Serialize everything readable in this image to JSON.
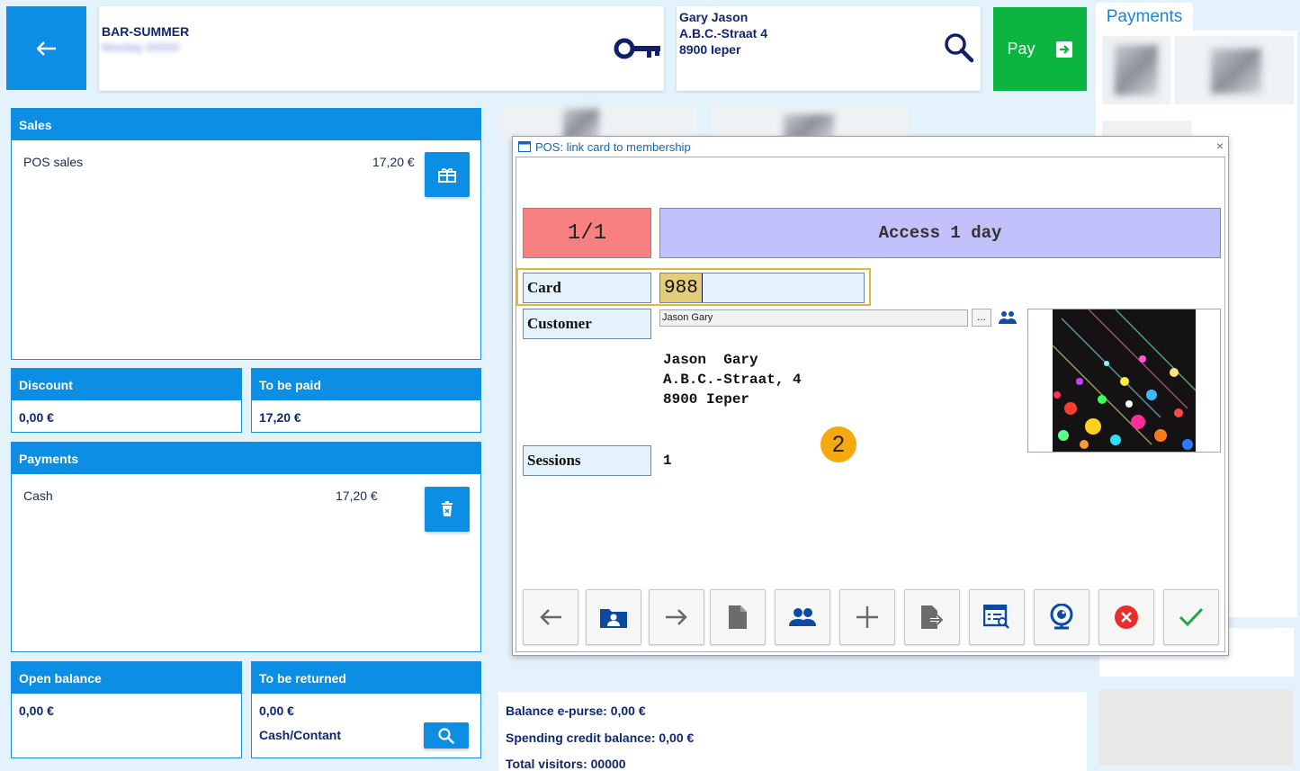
{
  "header": {
    "shop_name": "BAR-SUMMER",
    "shop_sub": "Monday 00000",
    "customer_lines": [
      "Gary  Jason",
      "A.B.C.-Straat 4",
      "8900 Ieper"
    ],
    "pay_label": "Pay",
    "payments_tab": "Payments"
  },
  "sales": {
    "title": "Sales",
    "item_label": "POS sales",
    "item_value": "17,20 €"
  },
  "discount": {
    "title": "Discount",
    "value": "0,00 €"
  },
  "to_be_paid": {
    "title": "To be paid",
    "value": "17,20 €"
  },
  "payments": {
    "title": "Payments",
    "item_label": "Cash",
    "item_value": "17,20 €"
  },
  "open_balance": {
    "title": "Open balance",
    "value": "0,00 €"
  },
  "to_be_returned": {
    "title": "To be returned",
    "value": "0,00 €",
    "method": "Cash/Contant"
  },
  "bottom_info": {
    "line1": "Balance e-purse: 0,00 €",
    "line2": "Spending credit balance: 0,00 €",
    "line3": "Total visitors: 00000"
  },
  "modal": {
    "title": "POS: link card to membership",
    "counter": "1/1",
    "product": "Access 1 day",
    "card_label": "Card",
    "card_value": "988",
    "customer_label": "Customer",
    "customer_value": "Jason Gary",
    "ellipsis": "...",
    "address_lines": [
      "Jason  Gary",
      "A.B.C.-Straat, 4",
      "8900 Ieper"
    ],
    "step_badge": "2",
    "sessions_label": "Sessions",
    "sessions_value": "1"
  },
  "colors": {
    "accent": "#0b8ee3",
    "pay": "#0bb53f",
    "counter_bg": "#f88080",
    "product_bg": "#c3c1fb",
    "highlight": "#e8b43c",
    "badge": "#f5a90e"
  }
}
